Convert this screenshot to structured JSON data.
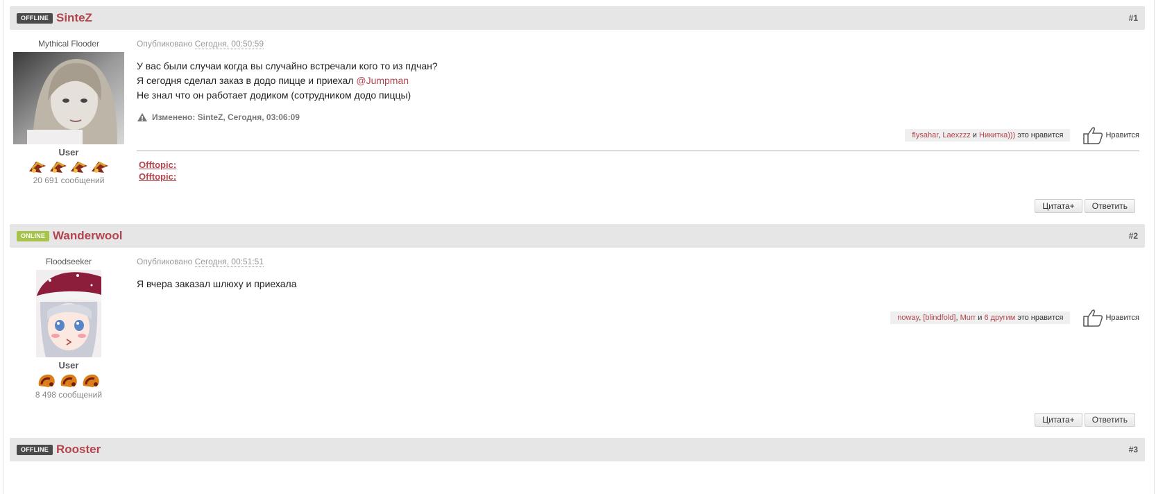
{
  "posts": [
    {
      "status": "OFFLINE",
      "author": "SinteZ",
      "number": "#1",
      "user_rank": "Mythical Flooder",
      "user_group": "User",
      "post_count": "20 691 сообщений",
      "published_label": "Опубликовано",
      "published_date": "Сегодня, 00:50:59",
      "text_lines": [
        "У вас были случаи когда вы случайно встречали кого то из пдчан?",
        "Я сегодня сделал заказ в додо пицце и приехал ",
        "Не знал что он работает додиком (сотрудником додо пиццы)"
      ],
      "mention": "@Jumpman",
      "edited": "Изменено: SinteZ, Сегодня, 03:06:09",
      "likers": [
        "flysahar",
        "Laexzzz",
        "Никитка)))"
      ],
      "likes_sep": ", ",
      "likes_and": " и ",
      "likes_suffix": " это нравится",
      "like_button": "Нравится",
      "offtopic": [
        "Offtopic:",
        "Offtopic:"
      ],
      "quote_button": "Цитата+",
      "reply_button": "Ответить"
    },
    {
      "status": "ONLINE",
      "author": "Wanderwool",
      "number": "#2",
      "user_rank": "Floodseeker",
      "user_group": "User",
      "post_count": "8 498 сообщений",
      "published_label": "Опубликовано",
      "published_date": "Сегодня, 00:51:51",
      "text_lines": [
        "Я вчера заказал шлюху и приехала"
      ],
      "likers": [
        "noway",
        "[blindfold]",
        "Murr"
      ],
      "likes_others": "6 другим",
      "likes_sep": ", ",
      "likes_and": " и ",
      "likes_suffix": " это нравится",
      "like_button": "Нравится",
      "quote_button": "Цитата+",
      "reply_button": "Ответить"
    },
    {
      "status": "OFFLINE",
      "author": "Rooster",
      "number": "#3"
    }
  ],
  "colors": {
    "accent": "#b3444e",
    "header_bg": "#e6e6e6",
    "offline_badge": "#4a4a4a",
    "online_badge": "#a6c34a"
  },
  "icons": {
    "warning": "warning-triangle-icon",
    "like": "thumbs-up-icon",
    "medal": "award-medal-icon"
  }
}
